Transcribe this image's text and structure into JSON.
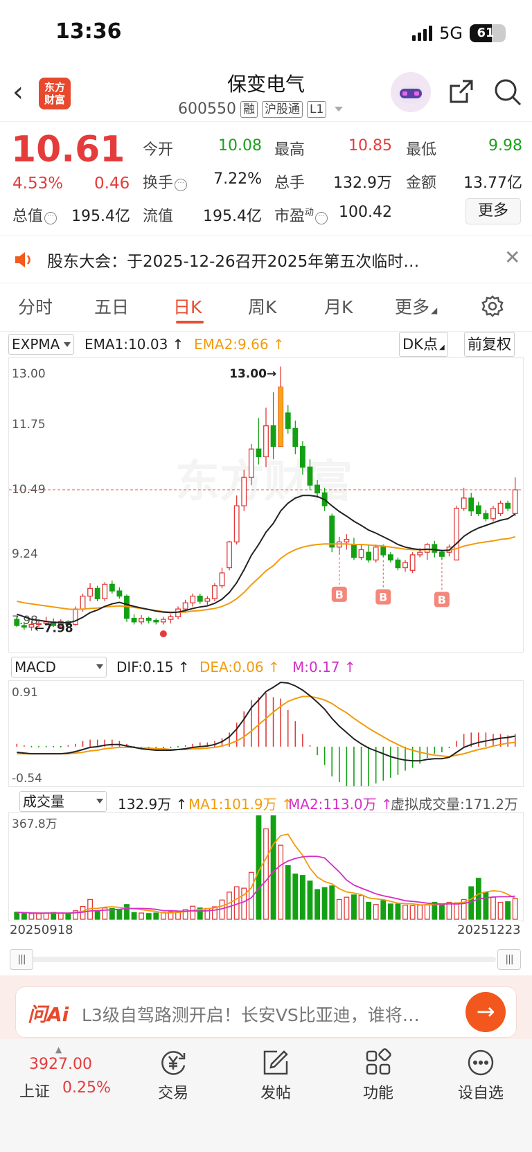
{
  "status_bar": {
    "time": "13:36",
    "network": "5G",
    "battery": "61",
    "battery_level": 0.61
  },
  "header": {
    "stock_name": "保变电气",
    "stock_code": "600550",
    "tags": [
      "融",
      "沪股通",
      "L1"
    ],
    "logo_text": "东方财富"
  },
  "quote": {
    "price": "10.61",
    "change_pct": "4.53%",
    "change": "0.46",
    "rows": [
      [
        {
          "label": "今开",
          "value": "10.08",
          "color": "green"
        },
        {
          "label": "最高",
          "value": "10.85",
          "color": "red"
        },
        {
          "label": "最低",
          "value": "9.98",
          "color": "green"
        }
      ],
      [
        {
          "label": "换手",
          "value": "7.22%",
          "color": "black",
          "info": true
        },
        {
          "label": "总手",
          "value": "132.9万",
          "color": "black"
        },
        {
          "label": "金额",
          "value": "13.77亿",
          "color": "black"
        }
      ]
    ],
    "total_value_label": "总值",
    "total_value": "195.4亿",
    "float_label": "流值",
    "float_value": "195.4亿",
    "pe_label": "市盈",
    "pe_sup": "动",
    "pe_value": "100.42",
    "more_button": "更多"
  },
  "notice": {
    "text": "股东大会：于2025-12-26召开2025年第五次临时…"
  },
  "tabs": [
    "分时",
    "五日",
    "日K",
    "周K",
    "月K",
    "更多"
  ],
  "active_tab": "日K",
  "main_indicator": {
    "selector": "EXPMA",
    "ema1": "EMA1:10.03",
    "ema2": "EMA2:9.66",
    "dk_button": "DK点",
    "adjust_button": "前复权",
    "watermark": "东方财富"
  },
  "chart_data": [
    {
      "type": "candlestick",
      "title": "",
      "y_ticks": [
        "13.00",
        "11.75",
        "10.49",
        "9.24",
        "7.98"
      ],
      "ylim": [
        7.98,
        13.0
      ],
      "max_annotation": "13.00→",
      "min_annotation": "←7.98",
      "buy_marker": "B",
      "ohlc": [
        [
          8.1,
          8.15,
          7.95,
          7.98
        ],
        [
          7.98,
          8.05,
          7.9,
          7.95
        ],
        [
          7.95,
          8.05,
          7.88,
          8.0
        ],
        [
          8.0,
          8.1,
          7.95,
          8.02
        ],
        [
          8.02,
          8.15,
          7.98,
          8.05
        ],
        [
          8.05,
          8.12,
          7.95,
          7.98
        ],
        [
          7.98,
          8.1,
          7.94,
          8.06
        ],
        [
          8.06,
          8.08,
          7.98,
          8.0
        ],
        [
          8.0,
          8.35,
          7.98,
          8.3
        ],
        [
          8.3,
          8.6,
          8.25,
          8.55
        ],
        [
          8.55,
          8.8,
          8.45,
          8.7
        ],
        [
          8.7,
          8.75,
          8.45,
          8.5
        ],
        [
          8.5,
          8.82,
          8.45,
          8.78
        ],
        [
          8.78,
          8.85,
          8.6,
          8.65
        ],
        [
          8.65,
          8.72,
          8.5,
          8.55
        ],
        [
          8.55,
          8.58,
          8.05,
          8.12
        ],
        [
          8.12,
          8.2,
          8.0,
          8.05
        ],
        [
          8.05,
          8.18,
          8.0,
          8.12
        ],
        [
          8.12,
          8.15,
          8.02,
          8.08
        ],
        [
          8.08,
          8.12,
          8.0,
          8.05
        ],
        [
          8.05,
          8.15,
          8.0,
          8.1
        ],
        [
          8.1,
          8.2,
          8.02,
          8.15
        ],
        [
          8.15,
          8.35,
          8.1,
          8.3
        ],
        [
          8.3,
          8.48,
          8.25,
          8.42
        ],
        [
          8.42,
          8.6,
          8.35,
          8.55
        ],
        [
          8.55,
          8.6,
          8.4,
          8.45
        ],
        [
          8.45,
          8.55,
          8.38,
          8.5
        ],
        [
          8.5,
          8.8,
          8.45,
          8.75
        ],
        [
          8.75,
          9.1,
          8.7,
          9.0
        ],
        [
          9.1,
          9.62,
          9.05,
          9.6
        ],
        [
          9.6,
          10.5,
          9.55,
          10.3
        ],
        [
          10.3,
          11.0,
          10.2,
          10.85
        ],
        [
          10.85,
          11.5,
          10.7,
          11.4
        ],
        [
          11.4,
          12.0,
          11.1,
          11.25
        ],
        [
          11.25,
          12.2,
          11.05,
          11.85
        ],
        [
          11.85,
          12.5,
          11.2,
          11.45
        ],
        [
          11.45,
          13.0,
          11.6,
          12.6
        ],
        [
          12.1,
          12.25,
          11.7,
          11.8
        ],
        [
          11.8,
          11.95,
          11.3,
          11.45
        ],
        [
          11.45,
          11.55,
          10.9,
          11.05
        ],
        [
          11.05,
          11.2,
          10.6,
          10.7
        ],
        [
          10.7,
          10.8,
          10.45,
          10.55
        ],
        [
          10.55,
          10.65,
          10.2,
          10.3
        ],
        [
          10.1,
          10.15,
          9.4,
          9.5
        ],
        [
          9.5,
          9.7,
          9.35,
          9.6
        ],
        [
          9.6,
          9.75,
          9.45,
          9.65
        ],
        [
          9.55,
          9.68,
          9.25,
          9.3
        ],
        [
          9.3,
          9.55,
          9.25,
          9.45
        ],
        [
          9.4,
          9.55,
          9.2,
          9.25
        ],
        [
          9.25,
          9.55,
          9.2,
          9.5
        ],
        [
          9.5,
          9.55,
          9.3,
          9.35
        ],
        [
          9.35,
          9.4,
          9.2,
          9.25
        ],
        [
          9.25,
          9.3,
          9.05,
          9.1
        ],
        [
          9.1,
          9.25,
          9.02,
          9.2
        ],
        [
          9.05,
          9.4,
          9.0,
          9.35
        ],
        [
          9.35,
          9.48,
          9.3,
          9.4
        ],
        [
          9.4,
          9.58,
          9.25,
          9.55
        ],
        [
          9.55,
          9.62,
          9.3,
          9.4
        ],
        [
          9.4,
          9.45,
          9.25,
          9.32
        ],
        [
          9.4,
          9.55,
          9.32,
          9.5
        ],
        [
          9.25,
          10.3,
          9.25,
          10.25
        ],
        [
          10.25,
          10.65,
          10.2,
          10.45
        ],
        [
          10.45,
          10.55,
          10.1,
          10.2
        ],
        [
          10.3,
          10.38,
          10.1,
          10.15
        ],
        [
          10.15,
          10.22,
          10.0,
          10.05
        ],
        [
          10.05,
          10.3,
          10.0,
          10.25
        ],
        [
          10.15,
          10.4,
          10.1,
          10.35
        ],
        [
          10.35,
          10.4,
          10.2,
          10.25
        ],
        [
          10.15,
          10.85,
          10.1,
          10.61
        ]
      ],
      "ema1": [
        8.2,
        8.15,
        8.1,
        8.08,
        8.06,
        8.04,
        8.04,
        8.03,
        8.07,
        8.14,
        8.23,
        8.28,
        8.35,
        8.4,
        8.43,
        8.39,
        8.35,
        8.32,
        8.29,
        8.26,
        8.24,
        8.23,
        8.24,
        8.27,
        8.31,
        8.34,
        8.36,
        8.41,
        8.49,
        8.62,
        8.81,
        9.06,
        9.34,
        9.55,
        9.79,
        9.96,
        10.2,
        10.35,
        10.45,
        10.5,
        10.5,
        10.48,
        10.42,
        10.3,
        10.19,
        10.1,
        10.0,
        9.92,
        9.83,
        9.77,
        9.7,
        9.63,
        9.55,
        9.5,
        9.47,
        9.45,
        9.46,
        9.45,
        9.43,
        9.44,
        9.57,
        9.71,
        9.8,
        9.87,
        9.92,
        9.97,
        10.02,
        10.05,
        10.14
      ],
      "ema2": [
        8.45,
        8.42,
        8.4,
        8.38,
        8.36,
        8.34,
        8.32,
        8.3,
        8.29,
        8.3,
        8.31,
        8.32,
        8.34,
        8.35,
        8.36,
        8.35,
        8.33,
        8.31,
        8.29,
        8.27,
        8.25,
        8.24,
        8.24,
        8.24,
        8.26,
        8.27,
        8.29,
        8.31,
        8.35,
        8.41,
        8.5,
        8.62,
        8.77,
        8.9,
        9.04,
        9.14,
        9.28,
        9.38,
        9.45,
        9.5,
        9.53,
        9.55,
        9.56,
        9.56,
        9.56,
        9.56,
        9.55,
        9.55,
        9.54,
        9.53,
        9.52,
        9.5,
        9.48,
        9.46,
        9.45,
        9.45,
        9.45,
        9.45,
        9.44,
        9.44,
        9.47,
        9.52,
        9.55,
        9.58,
        9.6,
        9.62,
        9.65,
        9.66,
        9.7
      ],
      "buy_points": [
        44,
        50,
        58
      ]
    },
    {
      "type": "line",
      "title": "MACD",
      "selector": "MACD",
      "dif_label": "DIF:0.15",
      "dea_label": "DEA:0.06",
      "m_label": "M:0.17",
      "y_ticks": [
        "0.91",
        "-0.54"
      ],
      "ylim": [
        -0.54,
        0.91
      ],
      "dif": [
        -0.08,
        -0.09,
        -0.1,
        -0.1,
        -0.1,
        -0.1,
        -0.1,
        -0.09,
        -0.07,
        -0.04,
        -0.01,
        0.0,
        0.02,
        0.03,
        0.03,
        0.01,
        -0.01,
        -0.03,
        -0.04,
        -0.05,
        -0.05,
        -0.05,
        -0.04,
        -0.03,
        -0.01,
        0.0,
        0.01,
        0.03,
        0.07,
        0.14,
        0.25,
        0.39,
        0.55,
        0.66,
        0.78,
        0.84,
        0.91,
        0.9,
        0.86,
        0.8,
        0.72,
        0.63,
        0.53,
        0.4,
        0.29,
        0.2,
        0.11,
        0.04,
        -0.02,
        -0.06,
        -0.1,
        -0.14,
        -0.17,
        -0.19,
        -0.2,
        -0.2,
        -0.18,
        -0.17,
        -0.17,
        -0.15,
        -0.08,
        -0.01,
        0.03,
        0.06,
        0.08,
        0.1,
        0.12,
        0.13,
        0.15
      ],
      "dea": [
        -0.1,
        -0.1,
        -0.1,
        -0.1,
        -0.1,
        -0.1,
        -0.1,
        -0.1,
        -0.09,
        -0.08,
        -0.06,
        -0.05,
        -0.03,
        -0.02,
        -0.01,
        -0.01,
        -0.01,
        -0.02,
        -0.02,
        -0.03,
        -0.03,
        -0.04,
        -0.04,
        -0.04,
        -0.03,
        -0.03,
        -0.02,
        -0.01,
        0.01,
        0.04,
        0.08,
        0.14,
        0.22,
        0.31,
        0.4,
        0.49,
        0.57,
        0.64,
        0.68,
        0.71,
        0.71,
        0.69,
        0.66,
        0.61,
        0.54,
        0.48,
        0.4,
        0.33,
        0.26,
        0.2,
        0.14,
        0.08,
        0.03,
        -0.02,
        -0.05,
        -0.08,
        -0.1,
        -0.12,
        -0.13,
        -0.14,
        -0.12,
        -0.1,
        -0.07,
        -0.04,
        -0.02,
        0.01,
        0.03,
        0.05,
        0.06
      ],
      "macd_bars": [
        0.04,
        0.02,
        0.0,
        0.0,
        0.0,
        0.0,
        0.0,
        0.02,
        0.04,
        0.08,
        0.1,
        0.1,
        0.1,
        0.1,
        0.08,
        0.04,
        0.0,
        -0.02,
        -0.04,
        -0.04,
        -0.04,
        -0.02,
        0.0,
        0.02,
        0.04,
        0.06,
        0.06,
        0.08,
        0.12,
        0.2,
        0.34,
        0.5,
        0.66,
        0.7,
        0.76,
        0.7,
        0.68,
        0.52,
        0.36,
        0.18,
        0.02,
        -0.12,
        -0.26,
        -0.42,
        -0.5,
        -0.56,
        -0.58,
        -0.58,
        -0.56,
        -0.52,
        -0.48,
        -0.44,
        -0.4,
        -0.34,
        -0.3,
        -0.24,
        -0.16,
        -0.1,
        -0.08,
        -0.02,
        0.08,
        0.18,
        0.2,
        0.2,
        0.2,
        0.18,
        0.18,
        0.16,
        0.18
      ]
    },
    {
      "type": "bar",
      "title": "成交量",
      "selector": "成交量",
      "vol_label": "132.9万",
      "ma1_label": "MA1:101.9万",
      "ma2_label": "MA2:113.0万",
      "virtual_label": "虚拟成交量:171.2万",
      "y_ticks": [
        "367.8万"
      ],
      "ylim": [
        0,
        367.8
      ],
      "x_start": "20250918",
      "x_end": "20251223",
      "volume": [
        25,
        22,
        20,
        20,
        22,
        24,
        22,
        20,
        30,
        45,
        70,
        28,
        40,
        38,
        34,
        52,
        24,
        22,
        20,
        22,
        24,
        26,
        28,
        34,
        46,
        40,
        38,
        44,
        68,
        96,
        115,
        110,
        166,
        366,
        320,
        366,
        262,
        190,
        160,
        155,
        135,
        105,
        112,
        118,
        70,
        78,
        86,
        84,
        60,
        52,
        66,
        54,
        54,
        50,
        48,
        50,
        52,
        60,
        54,
        60,
        58,
        70,
        115,
        145,
        96,
        78,
        60,
        62,
        73
      ]
    }
  ],
  "ask_ai": {
    "logo": "问Ai",
    "text": "L3级自驾路测开启！长安VS比亚迪，谁将…"
  },
  "bottom_nav": {
    "index_value": "3927.00",
    "index_name": "上证",
    "index_pct": "0.25%",
    "items": [
      {
        "label": "交易",
        "icon": "yen-icon"
      },
      {
        "label": "发帖",
        "icon": "edit-icon"
      },
      {
        "label": "功能",
        "icon": "grid-icon"
      },
      {
        "label": "设自选",
        "icon": "dots-icon"
      }
    ]
  }
}
